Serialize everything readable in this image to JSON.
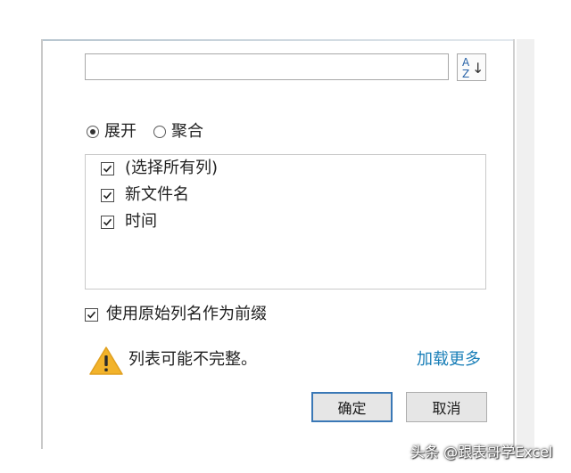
{
  "search": {
    "value": "",
    "placeholder": ""
  },
  "sort_button": {
    "icon": "sort-az-icon",
    "glyph_a": "A",
    "glyph_z": "Z",
    "glyph_arrow": "↓"
  },
  "mode": {
    "options": [
      {
        "label": "展开",
        "checked": true
      },
      {
        "label": "聚合",
        "checked": false
      }
    ]
  },
  "columns": {
    "items": [
      {
        "label": "(选择所有列)",
        "checked": true
      },
      {
        "label": "新文件名",
        "checked": true
      },
      {
        "label": "时间",
        "checked": true
      }
    ]
  },
  "prefix": {
    "label": "使用原始列名作为前缀",
    "checked": true
  },
  "warning": {
    "icon": "warning-icon",
    "text": "列表可能不完整。",
    "color": "#f2b32b"
  },
  "load_more": {
    "label": "加载更多",
    "color": "#1a7fb8"
  },
  "buttons": {
    "ok": "确定",
    "cancel": "取消"
  },
  "watermark": {
    "text": "头条 @跟表哥学Excel"
  }
}
